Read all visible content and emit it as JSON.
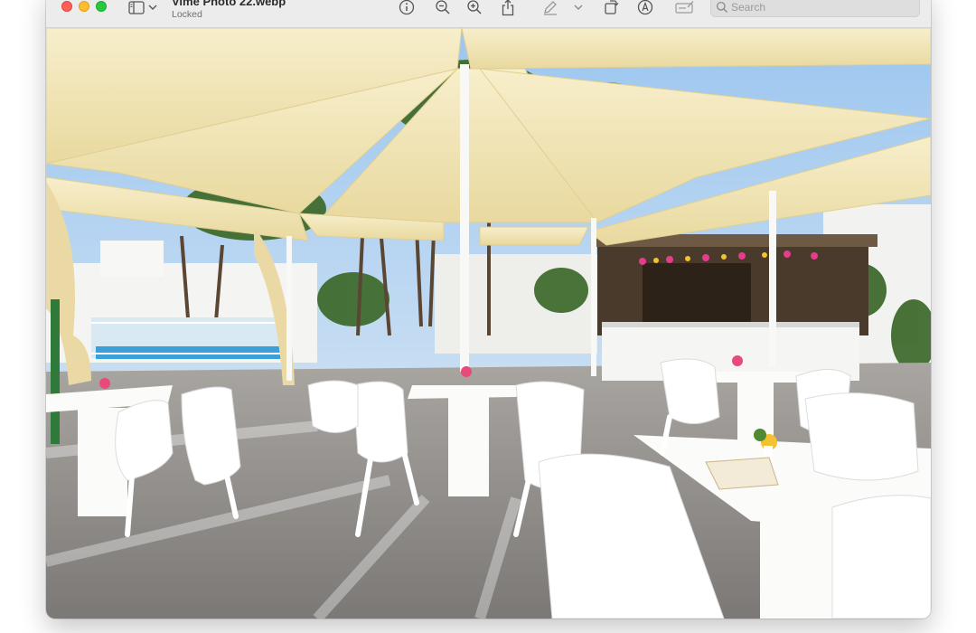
{
  "window": {
    "title": "Vime Photo 22.webp",
    "subtitle": "Locked"
  },
  "toolbar": {
    "sidebar_toggle_icon": "sidebar-icon",
    "sidebar_menu_icon": "chevron-down-icon",
    "info_icon": "info-icon",
    "zoom_out_icon": "zoom-out-icon",
    "zoom_in_icon": "zoom-in-icon",
    "share_icon": "share-icon",
    "markup_icon": "pen-icon",
    "markup_menu_icon": "chevron-down-icon",
    "rotate_icon": "rotate-icon",
    "annotate_icon": "annotate-icon",
    "form_icon": "form-fill-icon"
  },
  "search": {
    "placeholder": "Search",
    "value": ""
  },
  "image": {
    "subject": "outdoor pool bar terrace with cream shade sails, white chairs and tables"
  },
  "colors": {
    "titlebar": "#ececec",
    "sail": "#f3e6b8",
    "sky": "#c8def3",
    "floor": "#8d8985",
    "furniture": "#ffffff"
  }
}
